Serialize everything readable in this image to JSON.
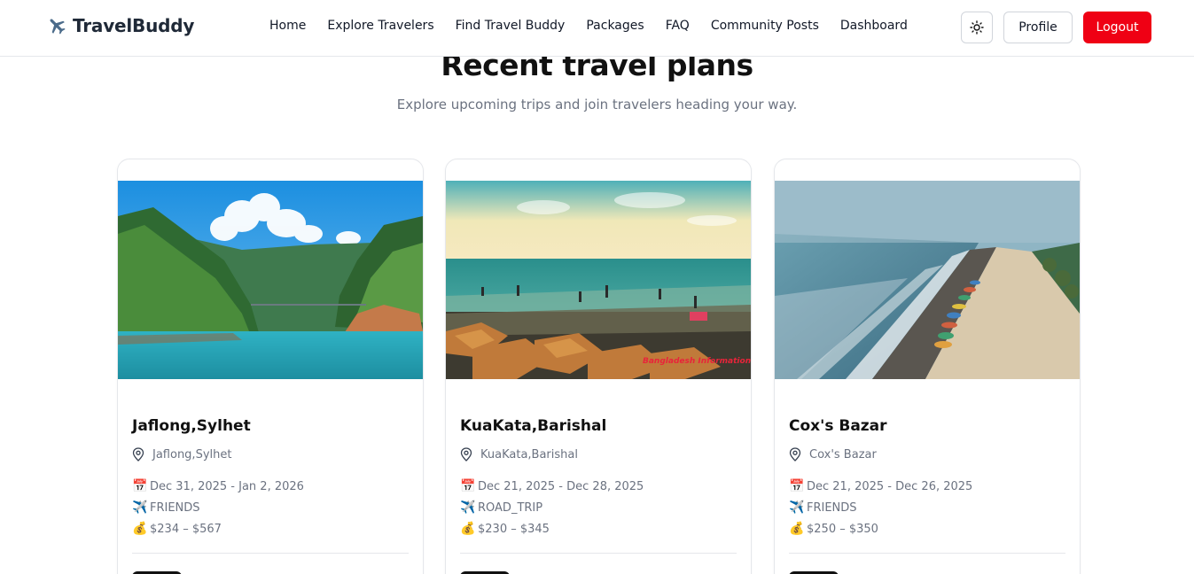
{
  "brand": {
    "name": "TravelBuddy",
    "icon": "airplane-icon"
  },
  "nav": {
    "links": [
      "Home",
      "Explore Travelers",
      "Find Travel Buddy",
      "Packages",
      "FAQ",
      "Community Posts",
      "Dashboard"
    ],
    "theme_icon": "sun-icon",
    "profile_label": "Profile",
    "logout_label": "Logout",
    "logout_color": "#ef0014"
  },
  "section": {
    "title": "Recent travel plans",
    "subtitle": "Explore upcoming trips and join travelers heading your way."
  },
  "cards": [
    {
      "title": "Jaflong,Sylhet",
      "location": "Jaflong,Sylhet",
      "dates": "Dec 31, 2025 - Jan 2, 2026",
      "type": "FRIENDS",
      "price": "$234 – $567",
      "image": "river-valley-photo"
    },
    {
      "title": "KuaKata,Barishal",
      "location": "KuaKata,Barishal",
      "dates": "Dec 21, 2025 - Dec 28, 2025",
      "type": "ROAD_TRIP",
      "price": "$230 – $345",
      "image": "beach-sunset-photo",
      "image_watermark": "Bangladesh Information"
    },
    {
      "title": "Cox's Bazar",
      "location": "Cox's Bazar",
      "dates": "Dec 21, 2025 - Dec 26, 2025",
      "type": "FRIENDS",
      "price": "$250 – $350",
      "image": "aerial-beach-photo"
    }
  ],
  "icons": {
    "date": "calendar-icon",
    "type": "airplane-icon",
    "price": "money-bag-icon",
    "location": "map-pin-icon"
  }
}
